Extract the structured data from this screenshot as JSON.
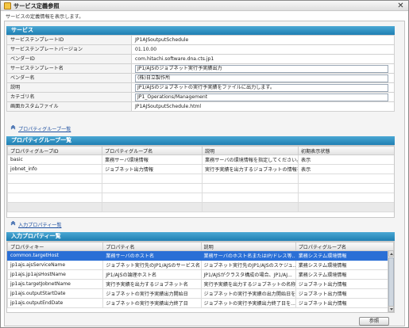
{
  "window": {
    "title": "サービス定義参照",
    "description": "サービスの定義情報を表示します。"
  },
  "service": {
    "header": "サービス",
    "rows": [
      {
        "key": "サービステンプレートID",
        "value": "JP1AJSoutputSchedule"
      },
      {
        "key": "サービステンプレートバージョン",
        "value": "01.10.00"
      },
      {
        "key": "ベンダーID",
        "value": "com.hitachi.software.dna.cts.jp1"
      },
      {
        "key": "サービステンプレート名",
        "value": "JP1/AJSのジョブネット実行予実績出力"
      },
      {
        "key": "ベンダー名",
        "value": "(株)日立製作所"
      },
      {
        "key": "説明",
        "value": "JP1/AJSのジョブネットの実行予実績をファイルに出力します。"
      },
      {
        "key": "カテゴリ名",
        "value": "JP1_Operations/Management"
      },
      {
        "key": "画面カスタムファイル",
        "value": "JP1AJSoutputSchedule.html"
      }
    ]
  },
  "property_groups": {
    "link": "プロパティグループ一覧",
    "header": "プロパティグループ一覧",
    "columns": [
      "プロパティグループID",
      "プロパティグループ名",
      "説明",
      "初期表示状態"
    ],
    "rows": [
      [
        "basic",
        "業務サーバ環境情報",
        "業務サーバの環境情報を指定してください。",
        "表示"
      ],
      [
        "jobnet_info",
        "ジョブネット出力情報",
        "実行予実績を出力するジョブネットの情報を...",
        "表示"
      ]
    ]
  },
  "input_properties": {
    "link": "入力プロパティ一覧",
    "header": "入力プロパティ一覧",
    "columns": [
      "プロパティキー",
      "プロパティ名",
      "説明",
      "プロパティグループ名"
    ],
    "rows": [
      [
        "common.targetHost",
        "業務サーバのホスト名",
        "業務サーバのホスト名またはIP/ドレス等...",
        "業務システム環境情報"
      ],
      [
        "jp1ajs.ajsServiceName",
        "ジョブネット実行先のJP1/AJSのサービス名",
        "ジョブネット実行先のJP1/AJSのスケジュ...",
        "業務システム環境情報"
      ],
      [
        "jp1ajs.jp1ajsHostName",
        "JP1/AJSの論理ホスト名",
        "JP1/AJSがクラスタ構成の場合、JP1/AJ...",
        "業務システム環境情報"
      ],
      [
        "jp1ajs.targetJobnetName",
        "実行予実績を出力するジョブネット名",
        "実行予実績を出力するジョブネットの名称を...",
        "ジョブネット出力情報"
      ],
      [
        "jp1ajs.outputStartDate",
        "ジョブネットの実行予実績出力開始日",
        "ジョブネットの実行予実績の出力開始日を...",
        "ジョブネット出力情報"
      ],
      [
        "jp1ajs.outputEndDate",
        "ジョブネットの実行予実績出力終了日",
        "ジョブネットの実行予実績出力終了日を...",
        "ジョブネット出力情報"
      ]
    ],
    "selected_row": 0
  },
  "footer": {
    "reference_button": "参照"
  }
}
